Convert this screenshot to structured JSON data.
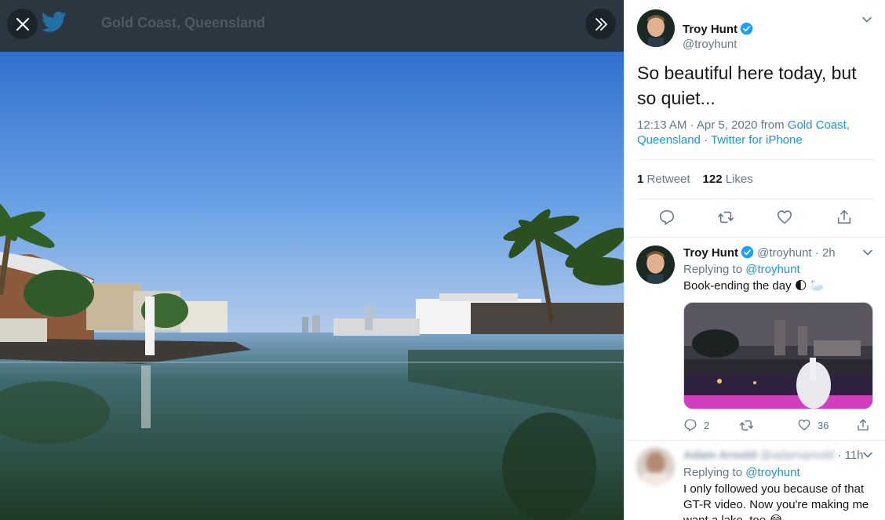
{
  "viewer": {
    "place_title": "Gold Coast, Queensland",
    "close_icon": "close-icon",
    "expand_icon": "chevron-double-right-icon",
    "bird_icon": "twitter-bird-icon"
  },
  "tweet": {
    "author_name": "Troy Hunt",
    "author_handle": "@troyhunt",
    "text": "So beautiful here today, but so quiet...",
    "time": "12:13 AM · Apr 5, 2020 from ",
    "location": "Gold Coast, Queensland",
    "separator": " · ",
    "source": "Twitter for iPhone",
    "retweets_count": "1",
    "retweets_label": "Retweet",
    "likes_count": "122",
    "likes_label": "Likes",
    "actions": [
      "reply-icon",
      "retweet-icon",
      "like-icon",
      "share-icon"
    ]
  },
  "replies": [
    {
      "author_name": "Troy Hunt",
      "author_handle": "@troyhunt",
      "time": "· 2h",
      "replying_label": "Replying to ",
      "replying_to": "@troyhunt",
      "text": "Book-ending the day 🌓 🦢",
      "reply_count": "2",
      "retweet_count": "",
      "like_count": "36"
    },
    {
      "author_name": "Adam Arnold",
      "author_handle": "@adamarnold",
      "time": "· 11h",
      "replying_label": "Replying to ",
      "replying_to": "@troyhunt",
      "text_line1": "I only followed you because of that",
      "text_line2": "GT-R video. Now you're making me",
      "text_line3": "want a lake, too 😂"
    }
  ],
  "colors": {
    "link": "#1b95e0",
    "verified": "#1da1f2",
    "muted": "#657786"
  }
}
